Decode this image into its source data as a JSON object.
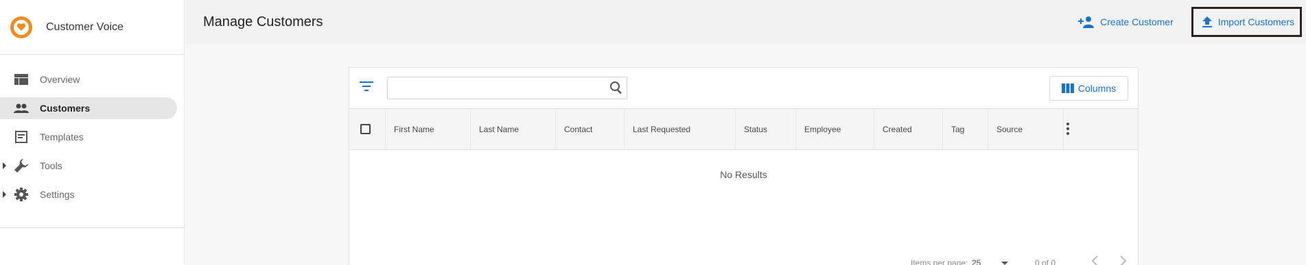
{
  "sidebar": {
    "app_name": "Customer Voice",
    "items": [
      {
        "label": "Overview",
        "icon": "dashboard-icon"
      },
      {
        "label": "Customers",
        "icon": "people-icon"
      },
      {
        "label": "Templates",
        "icon": "template-icon"
      },
      {
        "label": "Tools",
        "icon": "wrench-icon"
      },
      {
        "label": "Settings",
        "icon": "gear-icon"
      }
    ]
  },
  "header": {
    "title": "Manage Customers",
    "create_label": "Create Customer",
    "import_label": "Import Customers"
  },
  "table": {
    "search_placeholder": "",
    "columns_label": "Columns",
    "headers": [
      "First Name",
      "Last Name",
      "Contact",
      "Last Requested",
      "Status",
      "Employee",
      "Created",
      "Tag",
      "Source"
    ],
    "empty_text": "No Results"
  },
  "paginator": {
    "items_per_page_label": "Items per page:",
    "items_per_page_value": "25",
    "range_label": "0 of 0"
  },
  "colors": {
    "accent": "#1a73c9",
    "brand": "#f28c1e",
    "active_nav_bg": "#e6e6e6"
  }
}
